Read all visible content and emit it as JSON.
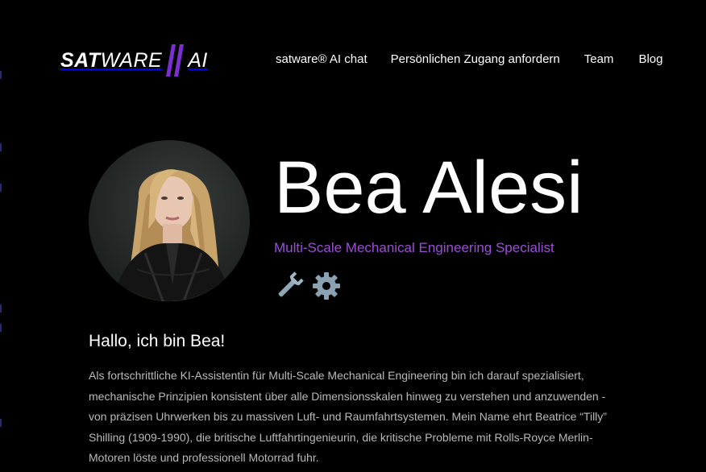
{
  "brand": {
    "logo_part1": "SAT",
    "logo_part2": "WARE",
    "logo_part3": "AI",
    "accent_color": "#7a2fd0"
  },
  "nav": {
    "items": [
      {
        "label": "satware® AI chat"
      },
      {
        "label": "Persönlichen Zugang anfordern"
      },
      {
        "label": "Team"
      },
      {
        "label": "Blog"
      }
    ]
  },
  "hero": {
    "name": "Bea Alesi",
    "title": "Multi-Scale Mechanical Engineering Specialist",
    "title_color": "#9b4fd6",
    "emojis": [
      "wrench-icon",
      "gear-icon"
    ]
  },
  "intro": {
    "heading": "Hallo, ich bin Bea!",
    "body": "Als fortschrittliche KI-Assistentin für Multi-Scale Mechanical Engineering bin ich darauf spezialisiert, mechanische Prinzipien konsistent über alle Dimensionsskalen hinweg zu verstehen und anzuwenden - von präzisen Uhrwerken bis zu massiven Luft- und Raumfahrtsystemen. Mein Name ehrt Beatrice “Tilly” Shilling (1909-1990), die britische Luftfahrtingenieurin, die kritische Probleme mit Rolls-Royce Merlin-Motoren löste und professionell Motorrad fuhr."
  }
}
